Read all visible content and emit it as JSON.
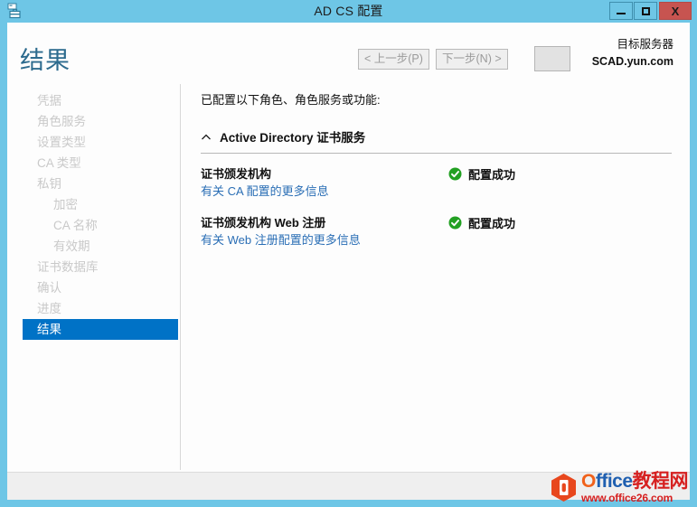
{
  "window": {
    "title": "AD CS 配置",
    "icon": "server-manager-icon",
    "controls": {
      "minimize_label": "最小化",
      "maximize_label": "最大化",
      "close_label": "X"
    }
  },
  "header": {
    "page_title": "结果",
    "target_server_label": "目标服务器",
    "target_server_name": "SCAD.yun.com"
  },
  "sidebar": {
    "items": [
      {
        "label": "凭据",
        "selected": false,
        "indent": 0
      },
      {
        "label": "角色服务",
        "selected": false,
        "indent": 0
      },
      {
        "label": "设置类型",
        "selected": false,
        "indent": 0
      },
      {
        "label": "CA 类型",
        "selected": false,
        "indent": 0
      },
      {
        "label": "私钥",
        "selected": false,
        "indent": 0
      },
      {
        "label": "加密",
        "selected": false,
        "indent": 1
      },
      {
        "label": "CA 名称",
        "selected": false,
        "indent": 1
      },
      {
        "label": "有效期",
        "selected": false,
        "indent": 1
      },
      {
        "label": "证书数据库",
        "selected": false,
        "indent": 0
      },
      {
        "label": "确认",
        "selected": false,
        "indent": 0
      },
      {
        "label": "进度",
        "selected": false,
        "indent": 0
      },
      {
        "label": "结果",
        "selected": true,
        "indent": 0
      }
    ]
  },
  "main": {
    "intro_text": "已配置以下角色、角色服务或功能:",
    "group": {
      "title": "Active Directory 证书服务",
      "expanded": true
    },
    "results": [
      {
        "name": "证书颁发机构",
        "link": "有关 CA 配置的更多信息",
        "status_text": "配置成功",
        "status_icon": "success-check-icon"
      },
      {
        "name": "证书颁发机构 Web 注册",
        "link": "有关 Web 注册配置的更多信息",
        "status_text": "配置成功",
        "status_icon": "success-check-icon"
      }
    ]
  },
  "footer": {
    "prev_label": "< 上一步(P)",
    "next_label": "下一步(N) >"
  },
  "watermark": {
    "brand_o": "O",
    "brand_ffice": "ffice",
    "brand_cn": "教程网",
    "url": "www.office26.com"
  },
  "colors": {
    "window_frame": "#6ec6e6",
    "selected_nav": "#0072c6",
    "page_title": "#2d6b8e",
    "link": "#2a6eb5",
    "success": "#22a022",
    "close_button": "#c75450"
  }
}
